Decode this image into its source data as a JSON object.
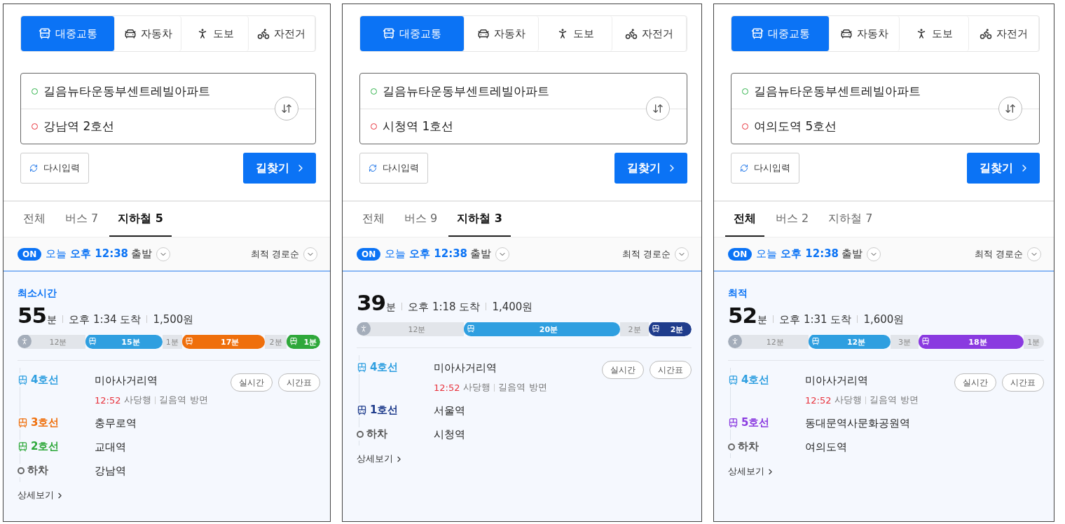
{
  "panels": [
    {
      "modes": [
        {
          "kind": "transit",
          "label": "대중교통",
          "selected": true
        },
        {
          "kind": "car",
          "label": "자동차",
          "selected": false
        },
        {
          "kind": "walk",
          "label": "도보",
          "selected": false
        },
        {
          "kind": "bike",
          "label": "자전거",
          "selected": false
        }
      ],
      "route": {
        "origin": "길음뉴타운동부센트레빌아파트",
        "destination": "강남역 2호선"
      },
      "reset_button": "다시입력",
      "search_button": "길찾기",
      "tabs": [
        {
          "label": "전체",
          "selected": false
        },
        {
          "label": "버스 7",
          "selected": false
        },
        {
          "label": "지하철 5",
          "selected": true
        }
      ],
      "depart": {
        "badge": "ON",
        "time": "오늘 **오후 12:38**",
        "word": "출발",
        "sort": "최적 경로순"
      },
      "result": {
        "tag": "최소시간",
        "minutes": "55",
        "unit": "분",
        "arrival": "오후 1:34 도착",
        "fare": "1,500원",
        "segments": [
          {
            "kind": "walk",
            "label": "12분"
          },
          {
            "kind": "line",
            "label": "15분",
            "color": "#2f9fe0"
          },
          {
            "kind": "gap",
            "label": "1분"
          },
          {
            "kind": "line",
            "label": "17분",
            "color": "#ef6f0c"
          },
          {
            "kind": "gap",
            "label": "2분"
          },
          {
            "kind": "line",
            "label": "1분",
            "color": "#2fa83b"
          }
        ],
        "steps": [
          {
            "kind": "line",
            "line": "4호선",
            "color": "#2f9fe0",
            "station": "미아사거리역",
            "arrival": "12:52",
            "direction": "사당행",
            "platform": "길음역 방면",
            "actions": [
              "실시간",
              "시간표"
            ]
          },
          {
            "kind": "line",
            "line": "3호선",
            "color": "#ef6f0c",
            "station": "충무로역"
          },
          {
            "kind": "line",
            "line": "2호선",
            "color": "#2fa83b",
            "station": "교대역"
          },
          {
            "kind": "exit",
            "line": "하차",
            "station": "강남역"
          }
        ],
        "more": "상세보기"
      }
    },
    {
      "modes": [
        {
          "kind": "transit",
          "label": "대중교통",
          "selected": true
        },
        {
          "kind": "car",
          "label": "자동차",
          "selected": false
        },
        {
          "kind": "walk",
          "label": "도보",
          "selected": false
        },
        {
          "kind": "bike",
          "label": "자전거",
          "selected": false
        }
      ],
      "route": {
        "origin": "길음뉴타운동부센트레빌아파트",
        "destination": "시청역 1호선"
      },
      "reset_button": "다시입력",
      "search_button": "길찾기",
      "tabs": [
        {
          "label": "전체",
          "selected": false
        },
        {
          "label": "버스 9",
          "selected": false
        },
        {
          "label": "지하철 3",
          "selected": true
        }
      ],
      "depart": {
        "badge": "ON",
        "time": "오늘 **오후 12:38**",
        "word": "출발",
        "sort": "최적 경로순"
      },
      "result": {
        "minutes": "39",
        "unit": "분",
        "arrival": "오후 1:18 도착",
        "fare": "1,400원",
        "segments": [
          {
            "kind": "walk",
            "label": "12분"
          },
          {
            "kind": "line",
            "label": "20분",
            "color": "#2f9fe0"
          },
          {
            "kind": "gap",
            "label": "2분"
          },
          {
            "kind": "line",
            "label": "2분",
            "color": "#1f3c8c"
          }
        ],
        "steps": [
          {
            "kind": "line",
            "line": "4호선",
            "color": "#2f9fe0",
            "station": "미아사거리역",
            "arrival": "12:52",
            "direction": "사당행",
            "platform": "길음역 방면",
            "actions": [
              "실시간",
              "시간표"
            ]
          },
          {
            "kind": "line",
            "line": "1호선",
            "color": "#1f3c8c",
            "station": "서울역"
          },
          {
            "kind": "exit",
            "line": "하차",
            "station": "시청역"
          }
        ],
        "more": "상세보기"
      }
    },
    {
      "modes": [
        {
          "kind": "transit",
          "label": "대중교통",
          "selected": true
        },
        {
          "kind": "car",
          "label": "자동차",
          "selected": false
        },
        {
          "kind": "walk",
          "label": "도보",
          "selected": false
        },
        {
          "kind": "bike",
          "label": "자전거",
          "selected": false
        }
      ],
      "route": {
        "origin": "길음뉴타운동부센트레빌아파트",
        "destination": "여의도역 5호선"
      },
      "reset_button": "다시입력",
      "search_button": "길찾기",
      "tabs": [
        {
          "label": "전체",
          "selected": true
        },
        {
          "label": "버스 2",
          "selected": false
        },
        {
          "label": "지하철 7",
          "selected": false
        }
      ],
      "depart": {
        "badge": "ON",
        "time": "오늘 **오후 12:38**",
        "word": "출발",
        "sort": "최적 경로순"
      },
      "result": {
        "tag": "최적",
        "minutes": "52",
        "unit": "분",
        "arrival": "오후 1:31 도착",
        "fare": "1,600원",
        "segments": [
          {
            "kind": "walk",
            "label": "12분"
          },
          {
            "kind": "line",
            "label": "12분",
            "color": "#2f9fe0"
          },
          {
            "kind": "gap",
            "label": "3분"
          },
          {
            "kind": "line",
            "label": "18분",
            "color": "#8a3ae0"
          },
          {
            "kind": "gap",
            "label": "1분"
          }
        ],
        "steps": [
          {
            "kind": "line",
            "line": "4호선",
            "color": "#2f9fe0",
            "station": "미아사거리역",
            "arrival": "12:52",
            "direction": "사당행",
            "platform": "길음역 방면",
            "actions": [
              "실시간",
              "시간표"
            ]
          },
          {
            "kind": "line",
            "line": "5호선",
            "color": "#8a3ae0",
            "station": "동대문역사문화공원역"
          },
          {
            "kind": "exit",
            "line": "하차",
            "station": "여의도역"
          }
        ],
        "more": "상세보기"
      }
    }
  ]
}
